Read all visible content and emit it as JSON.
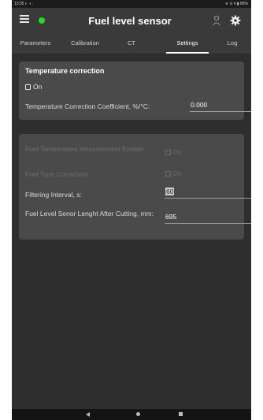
{
  "status_bar": {
    "time": "13:05",
    "left_icons": "◐ ◑ ·",
    "right_icons": "∗ ⊙ ▾ ▮ 86%"
  },
  "app_bar": {
    "title": "Fuel level sensor",
    "status_dot_color": "#22dd22"
  },
  "tabs": [
    {
      "label": "Parameters",
      "active": false
    },
    {
      "label": "Calibration",
      "active": false
    },
    {
      "label": "CT",
      "active": false
    },
    {
      "label": "Settings",
      "active": true
    },
    {
      "label": "Log",
      "active": false
    }
  ],
  "temperature_card": {
    "title": "Temperature correction",
    "on_label": "On",
    "coefficient_label": "Temperature Correction Coefficient, %/°C:",
    "coefficient_value": "0.000"
  },
  "settings_card": {
    "fuel_temp_measurement_label": "Fuel Temperature Measurement Enable:",
    "fuel_temp_measurement_on": "On",
    "fuel_type_correction_label": "Fuel Type Correction:",
    "fuel_type_correction_on": "On",
    "filtering_interval_label": "Filtering Interval, s:",
    "filtering_interval_value": "60",
    "sensor_length_label": "Fuel Level Senor Lenght After Cutting, mm:",
    "sensor_length_value": "695"
  },
  "colors": {
    "background": "#2e2e2e",
    "card": "#4a4a4a",
    "app_bar": "#3a3a3a",
    "disabled_text": "#6e6e6e"
  },
  "icons": [
    "menu-icon",
    "user-icon",
    "gear-icon",
    "back-icon",
    "home-icon",
    "recent-apps-icon"
  ]
}
